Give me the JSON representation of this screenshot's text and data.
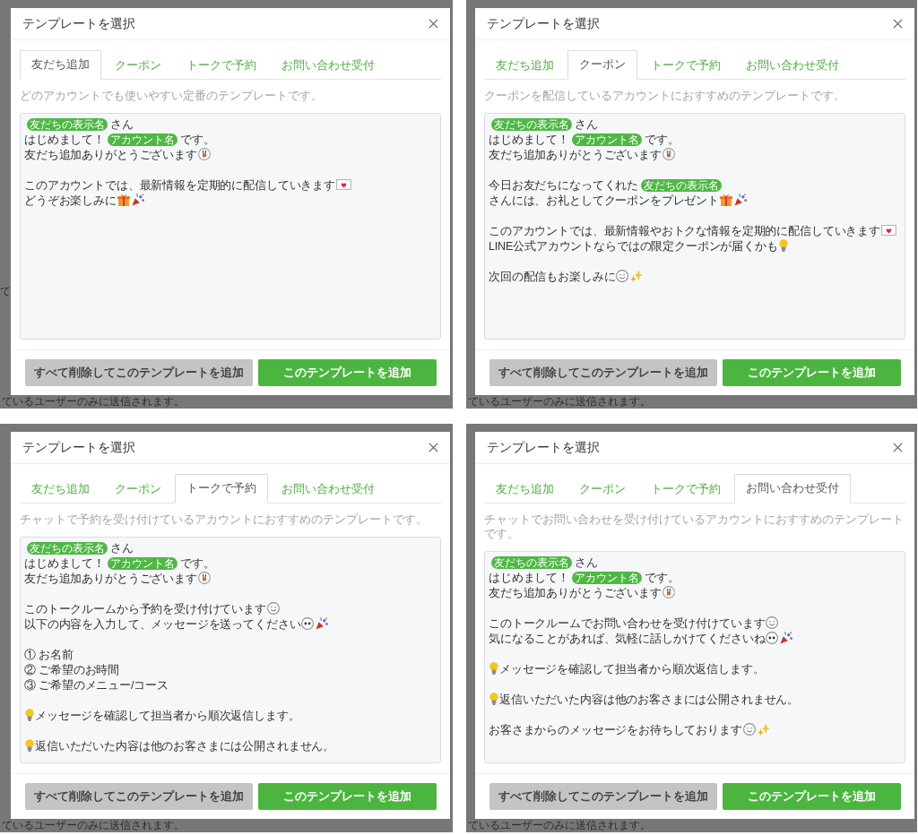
{
  "panels": [
    {
      "backdrop": {
        "side_text": "て",
        "footer_text": "ているユーザーのみに送信されます。"
      },
      "dialog": {
        "title": "テンプレートを選択",
        "tabs": [
          {
            "label": "友だち追加",
            "selected": true
          },
          {
            "label": "クーポン",
            "selected": false
          },
          {
            "label": "トークで予約",
            "selected": false
          },
          {
            "label": "お問い合わせ受付",
            "selected": false
          }
        ],
        "description": "どのアカウントでも使いやすい定番のテンプレートです。",
        "message": {
          "paragraphs": [
            {
              "lines": [
                {
                  "parts": [
                    {
                      "kind": "tag",
                      "text": "友だちの表示名"
                    },
                    {
                      "kind": "text",
                      "text": "さん"
                    }
                  ]
                },
                {
                  "parts": [
                    {
                      "kind": "text",
                      "text": "はじめまして！"
                    },
                    {
                      "kind": "tag",
                      "text": "アカウント名"
                    },
                    {
                      "kind": "text",
                      "text": "です。"
                    }
                  ]
                },
                {
                  "parts": [
                    {
                      "kind": "text",
                      "text": "友だち追加ありがとうございます"
                    },
                    {
                      "kind": "bunny"
                    }
                  ]
                }
              ]
            },
            {
              "lines": [
                {
                  "parts": [
                    {
                      "kind": "text",
                      "text": "このアカウントでは、最新情報を定期的に配信していきます"
                    },
                    {
                      "kind": "letter"
                    }
                  ]
                },
                {
                  "parts": [
                    {
                      "kind": "text",
                      "text": "どうぞお楽しみに"
                    },
                    {
                      "kind": "gift"
                    },
                    {
                      "kind": "confetti"
                    }
                  ]
                }
              ]
            }
          ]
        },
        "buttons": [
          {
            "label": "すべて削除してこのテンプレートを追加",
            "kind": "secondary"
          },
          {
            "label": "このテンプレートを追加",
            "kind": "primary"
          }
        ]
      }
    },
    {
      "backdrop": {
        "footer_text": "ているユーザーのみに送信されます。"
      },
      "dialog": {
        "title": "テンプレートを選択",
        "tabs": [
          {
            "label": "友だち追加",
            "selected": false
          },
          {
            "label": "クーポン",
            "selected": true
          },
          {
            "label": "トークで予約",
            "selected": false
          },
          {
            "label": "お問い合わせ受付",
            "selected": false
          }
        ],
        "description": "クーポンを配信しているアカウントにおすすめのテンプレートです。",
        "message": {
          "paragraphs": [
            {
              "lines": [
                {
                  "parts": [
                    {
                      "kind": "tag",
                      "text": "友だちの表示名"
                    },
                    {
                      "kind": "text",
                      "text": "さん"
                    }
                  ]
                },
                {
                  "parts": [
                    {
                      "kind": "text",
                      "text": "はじめまして！"
                    },
                    {
                      "kind": "tag",
                      "text": "アカウント名"
                    },
                    {
                      "kind": "text",
                      "text": "です。"
                    }
                  ]
                },
                {
                  "parts": [
                    {
                      "kind": "text",
                      "text": "友だち追加ありがとうございます"
                    },
                    {
                      "kind": "bunny"
                    }
                  ]
                }
              ]
            },
            {
              "lines": [
                {
                  "parts": [
                    {
                      "kind": "text",
                      "text": "今日お友だちになってくれた"
                    },
                    {
                      "kind": "tag",
                      "text": "友だちの表示名"
                    },
                    {
                      "kind": "text",
                      "text": "さんには、お礼としてクーポンをプレゼント"
                    },
                    {
                      "kind": "gift"
                    },
                    {
                      "kind": "confetti"
                    }
                  ]
                }
              ]
            },
            {
              "lines": [
                {
                  "parts": [
                    {
                      "kind": "text",
                      "text": "このアカウントでは、最新情報やおトクな情報を定期的に配信していきます"
                    },
                    {
                      "kind": "letter"
                    }
                  ]
                },
                {
                  "parts": [
                    {
                      "kind": "text",
                      "text": "LINE公式アカウントならではの限定クーポンが届くかも"
                    },
                    {
                      "kind": "bulb"
                    }
                  ]
                }
              ]
            },
            {
              "lines": [
                {
                  "parts": [
                    {
                      "kind": "text",
                      "text": "次回の配信もお楽しみに"
                    },
                    {
                      "kind": "smile"
                    },
                    {
                      "kind": "sparkle"
                    }
                  ]
                }
              ]
            }
          ]
        },
        "buttons": [
          {
            "label": "すべて削除してこのテンプレートを追加",
            "kind": "secondary"
          },
          {
            "label": "このテンプレートを追加",
            "kind": "primary"
          }
        ]
      }
    },
    {
      "backdrop": {
        "footer_text": "ているユーザーのみに送信されます。"
      },
      "dialog": {
        "title": "テンプレートを選択",
        "tabs": [
          {
            "label": "友だち追加",
            "selected": false
          },
          {
            "label": "クーポン",
            "selected": false
          },
          {
            "label": "トークで予約",
            "selected": true
          },
          {
            "label": "お問い合わせ受付",
            "selected": false
          }
        ],
        "description": "チャットで予約を受け付けているアカウントにおすすめのテンプレートです。",
        "message": {
          "paragraphs": [
            {
              "lines": [
                {
                  "parts": [
                    {
                      "kind": "tag",
                      "text": "友だちの表示名"
                    },
                    {
                      "kind": "text",
                      "text": "さん"
                    }
                  ]
                },
                {
                  "parts": [
                    {
                      "kind": "text",
                      "text": "はじめまして！"
                    },
                    {
                      "kind": "tag",
                      "text": "アカウント名"
                    },
                    {
                      "kind": "text",
                      "text": "です。"
                    }
                  ]
                },
                {
                  "parts": [
                    {
                      "kind": "text",
                      "text": "友だち追加ありがとうございます"
                    },
                    {
                      "kind": "bunny"
                    }
                  ]
                }
              ]
            },
            {
              "lines": [
                {
                  "parts": [
                    {
                      "kind": "text",
                      "text": "このトークルームから予約を受け付けています"
                    },
                    {
                      "kind": "smile"
                    }
                  ]
                },
                {
                  "parts": [
                    {
                      "kind": "text",
                      "text": "以下の内容を入力して、メッセージを送ってください"
                    },
                    {
                      "kind": "stare"
                    },
                    {
                      "kind": "confetti"
                    }
                  ]
                }
              ]
            },
            {
              "lines": [
                {
                  "parts": [
                    {
                      "kind": "text",
                      "text": "① お名前"
                    }
                  ]
                },
                {
                  "parts": [
                    {
                      "kind": "text",
                      "text": "② ご希望のお時間"
                    }
                  ]
                },
                {
                  "parts": [
                    {
                      "kind": "text",
                      "text": "③ ご希望のメニュー/コース"
                    }
                  ]
                }
              ]
            },
            {
              "lines": [
                {
                  "parts": [
                    {
                      "kind": "bulb"
                    },
                    {
                      "kind": "text",
                      "text": "メッセージを確認して担当者から順次返信します。"
                    }
                  ]
                }
              ]
            },
            {
              "lines": [
                {
                  "parts": [
                    {
                      "kind": "bulb"
                    },
                    {
                      "kind": "text",
                      "text": "返信いただいた内容は他のお客さまには公開されません。"
                    }
                  ]
                }
              ]
            }
          ]
        },
        "buttons": [
          {
            "label": "すべて削除してこのテンプレートを追加",
            "kind": "secondary"
          },
          {
            "label": "このテンプレートを追加",
            "kind": "primary"
          }
        ]
      }
    },
    {
      "backdrop": {
        "footer_text": "ているユーザーのみに送信されます。"
      },
      "dialog": {
        "title": "テンプレートを選択",
        "tabs": [
          {
            "label": "友だち追加",
            "selected": false
          },
          {
            "label": "クーポン",
            "selected": false
          },
          {
            "label": "トークで予約",
            "selected": false
          },
          {
            "label": "お問い合わせ受付",
            "selected": true
          }
        ],
        "description": "チャットでお問い合わせを受け付けているアカウントにおすすめのテンプレートです。",
        "message": {
          "paragraphs": [
            {
              "lines": [
                {
                  "parts": [
                    {
                      "kind": "tag",
                      "text": "友だちの表示名"
                    },
                    {
                      "kind": "text",
                      "text": "さん"
                    }
                  ]
                },
                {
                  "parts": [
                    {
                      "kind": "text",
                      "text": "はじめまして！"
                    },
                    {
                      "kind": "tag",
                      "text": "アカウント名"
                    },
                    {
                      "kind": "text",
                      "text": "です。"
                    }
                  ]
                },
                {
                  "parts": [
                    {
                      "kind": "text",
                      "text": "友だち追加ありがとうございます"
                    },
                    {
                      "kind": "bunny"
                    }
                  ]
                }
              ]
            },
            {
              "lines": [
                {
                  "parts": [
                    {
                      "kind": "text",
                      "text": "このトークルームでお問い合わせを受け付けています"
                    },
                    {
                      "kind": "smile"
                    }
                  ]
                },
                {
                  "parts": [
                    {
                      "kind": "text",
                      "text": "気になることがあれば、気軽に話しかけてくださいね"
                    },
                    {
                      "kind": "stare"
                    },
                    {
                      "kind": "confetti"
                    }
                  ]
                }
              ]
            },
            {
              "lines": [
                {
                  "parts": [
                    {
                      "kind": "bulb"
                    },
                    {
                      "kind": "text",
                      "text": "メッセージを確認して担当者から順次返信します。"
                    }
                  ]
                }
              ]
            },
            {
              "lines": [
                {
                  "parts": [
                    {
                      "kind": "bulb"
                    },
                    {
                      "kind": "text",
                      "text": "返信いただいた内容は他のお客さまには公開されません。"
                    }
                  ]
                }
              ]
            },
            {
              "lines": [
                {
                  "parts": [
                    {
                      "kind": "text",
                      "text": "お客さまからのメッセージをお待ちしております"
                    },
                    {
                      "kind": "smile"
                    },
                    {
                      "kind": "sparkle"
                    }
                  ]
                }
              ]
            }
          ]
        },
        "buttons": [
          {
            "label": "すべて削除してこのテンプレートを追加",
            "kind": "secondary"
          },
          {
            "label": "このテンプレートを追加",
            "kind": "primary"
          }
        ]
      }
    }
  ]
}
